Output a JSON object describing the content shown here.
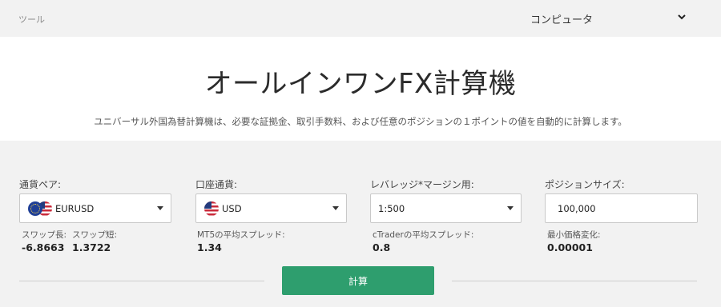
{
  "topbar": {
    "crumb": "ツール",
    "platform_value": "コンピュータ"
  },
  "hero": {
    "title": "オールインワンFX計算機",
    "description": "ユニバーサル外国為替計算機は、必要な証拠金、取引手数料、および任意のポジションの１ポイントの値を自動的に計算します。"
  },
  "form": {
    "pair": {
      "label": "通貨ペア:",
      "value": "EURUSD"
    },
    "account_currency": {
      "label": "口座通貨:",
      "value": "USD"
    },
    "leverage": {
      "label": "レバレッジ*マージン用:",
      "value": "1:500"
    },
    "position_size": {
      "label": "ポジションサイズ:",
      "value": "100,000"
    }
  },
  "stats": {
    "swap_long": {
      "label": "スワップ長:",
      "value": "-6.8663"
    },
    "swap_short": {
      "label": "スワップ短:",
      "value": "1.3722"
    },
    "mt5_spread": {
      "label": "MT5の平均スプレッド:",
      "value": "1.34"
    },
    "ctrader_spread": {
      "label": "cTraderの平均スプレッド:",
      "value": "0.8"
    },
    "min_price_change": {
      "label": "最小価格変化:",
      "value": "0.00001"
    }
  },
  "actions": {
    "calculate_label": "計算"
  },
  "icons": {
    "dropdown": "chevron-down-icon",
    "select": "caret-down-icon",
    "flag_eu": "eu-flag-icon",
    "flag_us": "us-flag-icon"
  },
  "colors": {
    "accent": "#2e9e6e",
    "page_bg": "#f2f2f2"
  }
}
